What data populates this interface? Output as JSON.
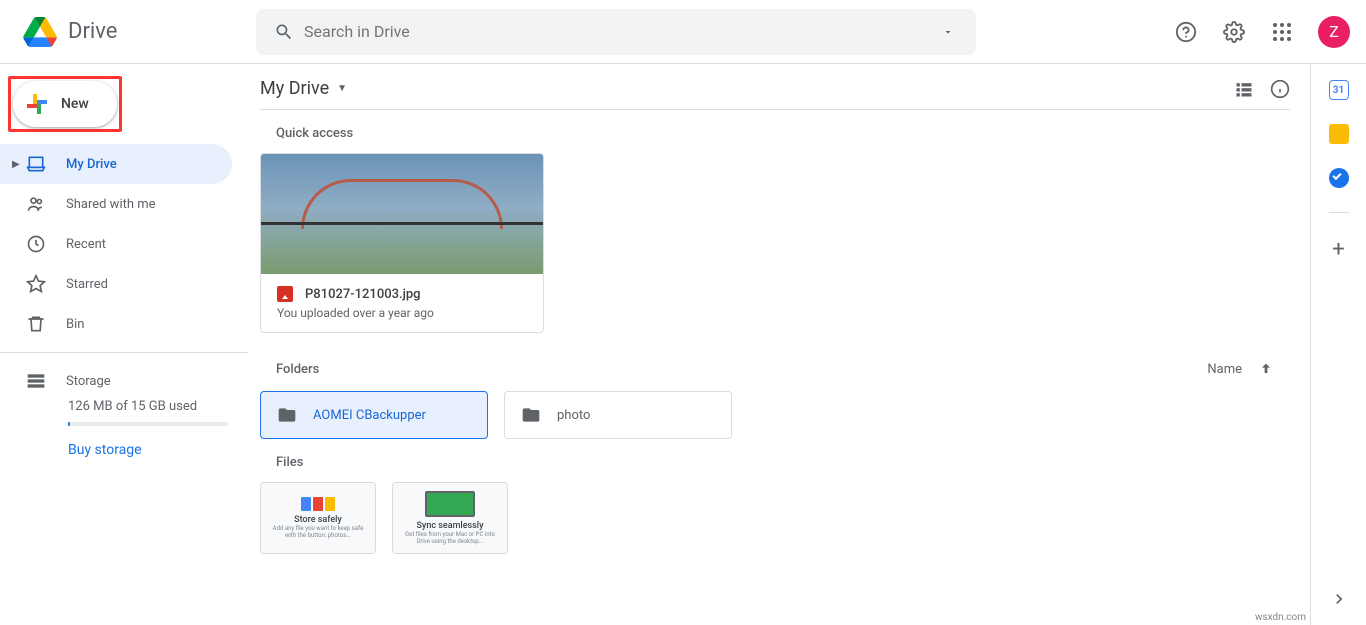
{
  "header": {
    "app_name": "Drive",
    "search_placeholder": "Search in Drive",
    "avatar_initial": "Z"
  },
  "sidebar": {
    "new_label": "New",
    "items": [
      {
        "label": "My Drive",
        "icon": "drive"
      },
      {
        "label": "Shared with me",
        "icon": "people"
      },
      {
        "label": "Recent",
        "icon": "clock"
      },
      {
        "label": "Starred",
        "icon": "star"
      },
      {
        "label": "Bin",
        "icon": "trash"
      }
    ],
    "storage_label": "Storage",
    "storage_used": "126 MB of 15 GB used",
    "buy_label": "Buy storage"
  },
  "main": {
    "breadcrumb": "My Drive",
    "quick_label": "Quick access",
    "quick_item": {
      "name": "P81027-121003.jpg",
      "subtitle": "You uploaded over a year ago"
    },
    "folders_label": "Folders",
    "sort_label": "Name",
    "folders": [
      {
        "name": "AOMEI CBackupper"
      },
      {
        "name": "photo"
      }
    ],
    "files_label": "Files",
    "file_cards": [
      {
        "title": "Store safely",
        "sub": "Add any file you want to keep safe with the button: photos..."
      },
      {
        "title": "Sync seamlessly",
        "sub": "Get files from your Mac or PC into Drive using the desktop..."
      }
    ]
  },
  "attribution": "wsxdn.com"
}
